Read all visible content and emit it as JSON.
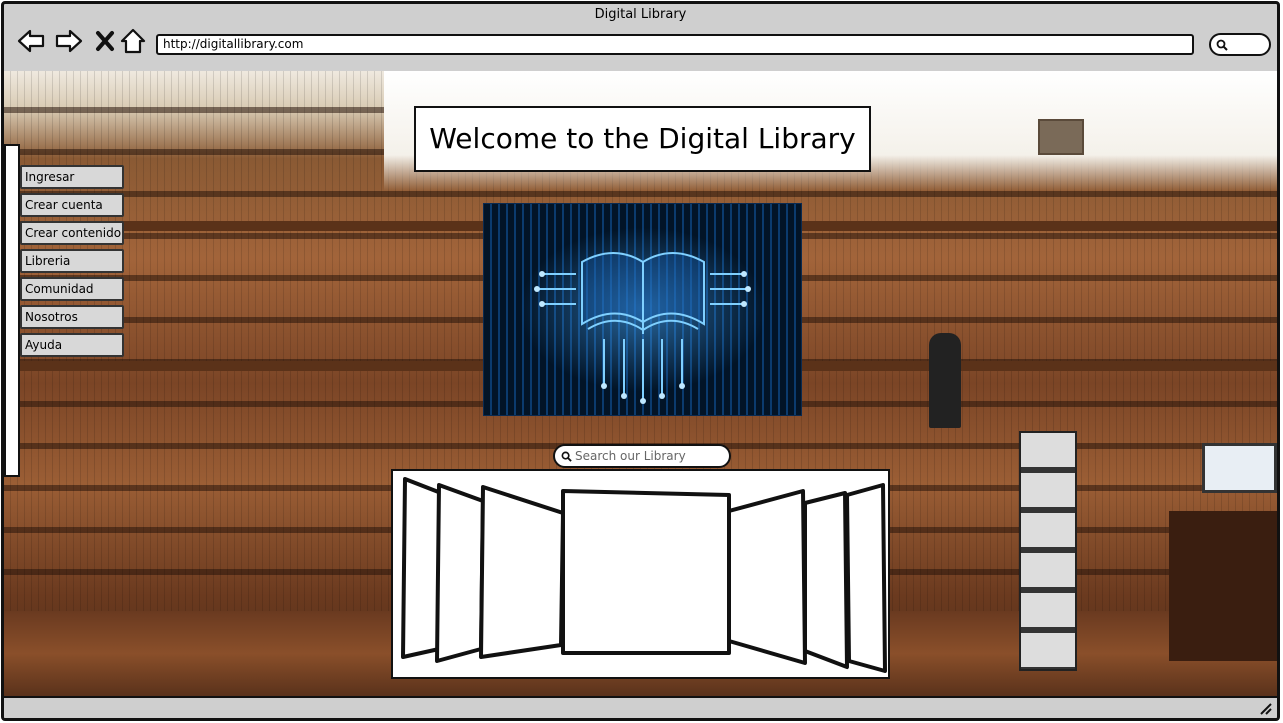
{
  "window": {
    "title": "Digital Library"
  },
  "browser": {
    "url": "http://digitallibrary.com",
    "nav": [
      {
        "name": "back-arrow-icon"
      },
      {
        "name": "forward-arrow-icon"
      },
      {
        "name": "close-x-icon"
      },
      {
        "name": "home-icon"
      }
    ],
    "search_icon": "magnifier-icon"
  },
  "page": {
    "hero_title": "Welcome to the Digital Library",
    "hero_image_alt": "glowing-digital-book-image",
    "background_alt": "library-interior-photo"
  },
  "menu": {
    "items": [
      {
        "label": "Ingresar"
      },
      {
        "label": "Crear cuenta"
      },
      {
        "label": "Crear contenido"
      },
      {
        "label": "Libreria"
      },
      {
        "label": "Comunidad"
      },
      {
        "label": "Nosotros"
      },
      {
        "label": "Ayuda"
      }
    ]
  },
  "search": {
    "placeholder": "Search our Library",
    "value": ""
  },
  "colors": {
    "chrome": "#cfcfcf",
    "border": "#111111",
    "menu_bg": "#d8d8d8",
    "hero_glow": "#46aaff"
  }
}
